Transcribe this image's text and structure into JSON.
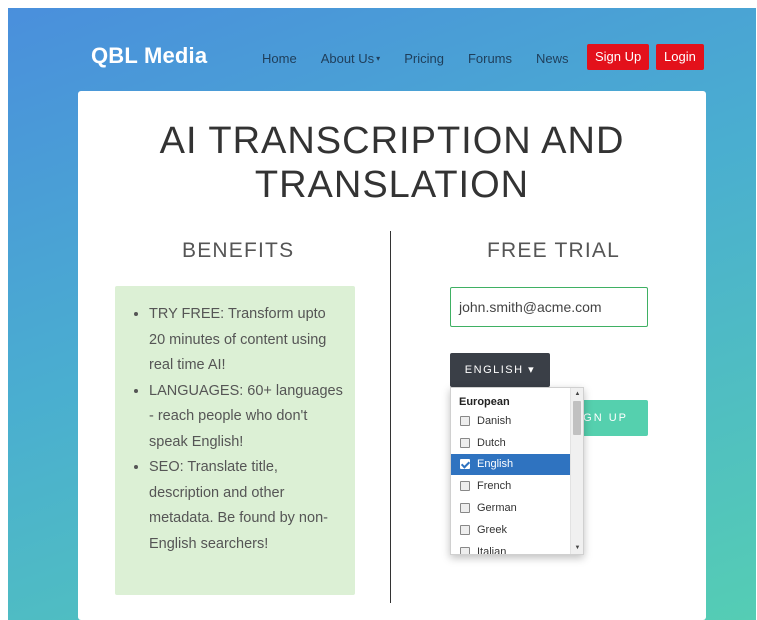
{
  "nav": {
    "brand": "QBL Media",
    "links": [
      {
        "label": "Home"
      },
      {
        "label": "About Us",
        "caret": "▾"
      },
      {
        "label": "Pricing"
      },
      {
        "label": "Forums"
      },
      {
        "label": "News"
      }
    ],
    "signup_label": "Sign Up",
    "login_label": "Login"
  },
  "hero": {
    "title_line1": "AI TRANSCRIPTION AND",
    "title_line2": "TRANSLATION"
  },
  "benefits": {
    "title": "BENEFITS",
    "items": [
      "TRY FREE: Transform upto 20 minutes of content using real time AI!",
      "LANGUAGES: 60+ languages - reach people who don't speak English!",
      "SEO: Translate title, description and other metadata. Be found by non-English searchers!"
    ]
  },
  "trial": {
    "title": "FREE TRIAL",
    "email_value": "john.smith@acme.com",
    "language_button": "ENGLISH",
    "language_caret": "▾",
    "signup_button": "SIGN UP",
    "dropdown": {
      "group": "European",
      "options": [
        {
          "label": "Danish",
          "checked": false
        },
        {
          "label": "Dutch",
          "checked": false
        },
        {
          "label": "English",
          "checked": true
        },
        {
          "label": "French",
          "checked": false
        },
        {
          "label": "German",
          "checked": false
        },
        {
          "label": "Greek",
          "checked": false
        },
        {
          "label": "Italian",
          "checked": false
        }
      ]
    }
  },
  "colors": {
    "gradient_start": "#4a8fdc",
    "gradient_end": "#55cdb4",
    "red_button": "#e3111b",
    "green_button": "#55d0ae",
    "benefits_bg": "#dcf0d5",
    "selected_option": "#2f73c0"
  }
}
